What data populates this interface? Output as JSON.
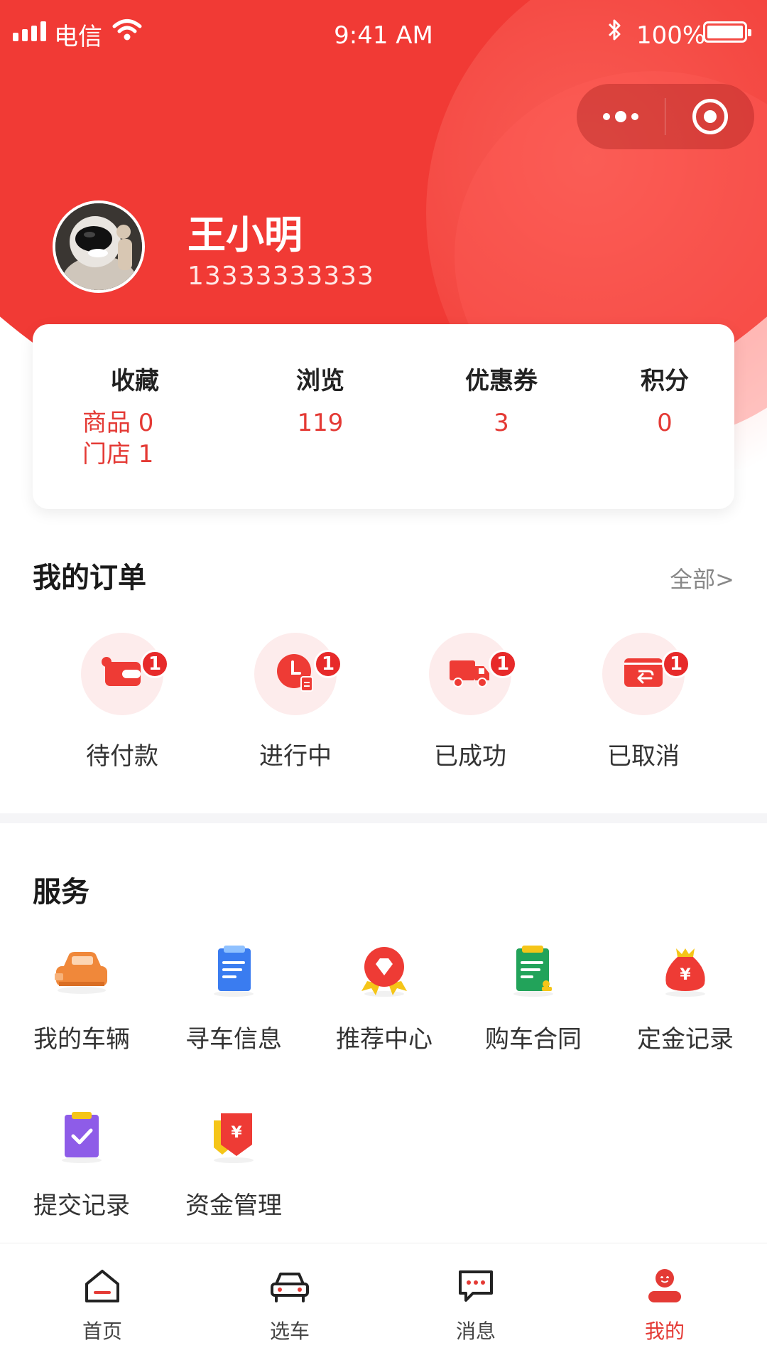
{
  "status_bar": {
    "carrier": "电信",
    "time": "9:41 AM",
    "battery": "100%"
  },
  "profile": {
    "name": "王小明",
    "phone": "13333333333"
  },
  "stats": {
    "favorites": {
      "title": "收藏",
      "goods": "商品 0",
      "stores": "门店 1"
    },
    "browse": {
      "title": "浏览",
      "value": "119"
    },
    "coupons": {
      "title": "优惠券",
      "value": "3"
    },
    "points": {
      "title": "积分",
      "value": "0"
    }
  },
  "orders": {
    "title": "我的订单",
    "all_label": "全部>",
    "items": [
      {
        "label": "待付款",
        "badge": "1",
        "icon": "wallet-icon"
      },
      {
        "label": "进行中",
        "badge": "1",
        "icon": "clock-icon"
      },
      {
        "label": "已成功",
        "badge": "1",
        "icon": "truck-icon"
      },
      {
        "label": "已取消",
        "badge": "1",
        "icon": "return-icon"
      }
    ]
  },
  "services": {
    "title": "服务",
    "items": [
      {
        "label": "我的车辆",
        "icon": "car-icon",
        "color": "#f0883a"
      },
      {
        "label": "寻车信息",
        "icon": "document-icon",
        "color": "#3a7cf0"
      },
      {
        "label": "推荐中心",
        "icon": "diamond-badge-icon",
        "color": "#ee3b35"
      },
      {
        "label": "购车合同",
        "icon": "contract-icon",
        "color": "#22a35a"
      },
      {
        "label": "定金记录",
        "icon": "money-bag-icon",
        "color": "#ee3b35"
      },
      {
        "label": "提交记录",
        "icon": "checklist-icon",
        "color": "#8e5ce8"
      },
      {
        "label": "资金管理",
        "icon": "fund-icon",
        "color": "#ee3b35"
      }
    ]
  },
  "tabbar": {
    "items": [
      {
        "label": "首页",
        "icon": "home-icon"
      },
      {
        "label": "选车",
        "icon": "car-outline-icon"
      },
      {
        "label": "消息",
        "icon": "message-icon"
      },
      {
        "label": "我的",
        "icon": "user-icon",
        "active": true
      }
    ]
  },
  "colors": {
    "brand_red": "#f13a35",
    "accent_text": "#e43a35",
    "badge": "#e72a2a"
  }
}
